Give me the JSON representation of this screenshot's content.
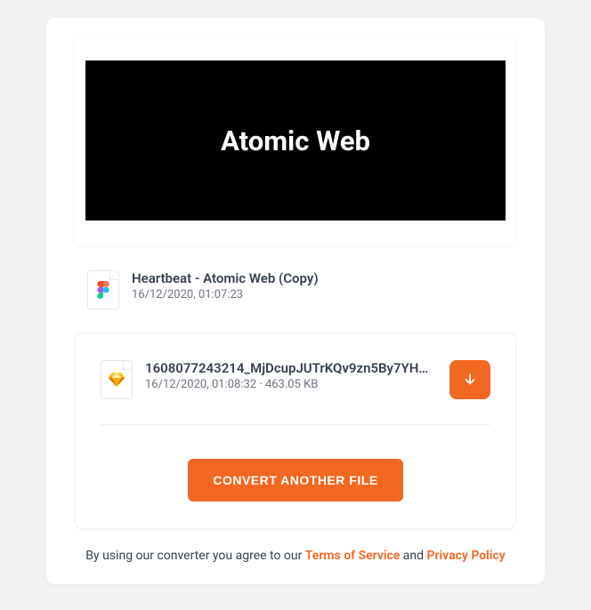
{
  "preview": {
    "title": "Atomic Web"
  },
  "source": {
    "name": "Heartbeat - Atomic Web (Copy)",
    "timestamp": "16/12/2020, 01:07:23",
    "icon_type": "figma"
  },
  "output": {
    "name": "1608077243214_MjDcupJUTrKQv9zn5By7YH…",
    "info": "16/12/2020, 01:08:32 · 463.05 KB",
    "icon_type": "sketch"
  },
  "actions": {
    "convert_label": "CONVERT ANOTHER FILE",
    "download_label": "Download"
  },
  "footer": {
    "text_prefix": "By using our converter you agree to our ",
    "tos": "Terms of Service",
    "and": " and ",
    "privacy": "Privacy Policy"
  },
  "colors": {
    "accent": "#f26722"
  }
}
